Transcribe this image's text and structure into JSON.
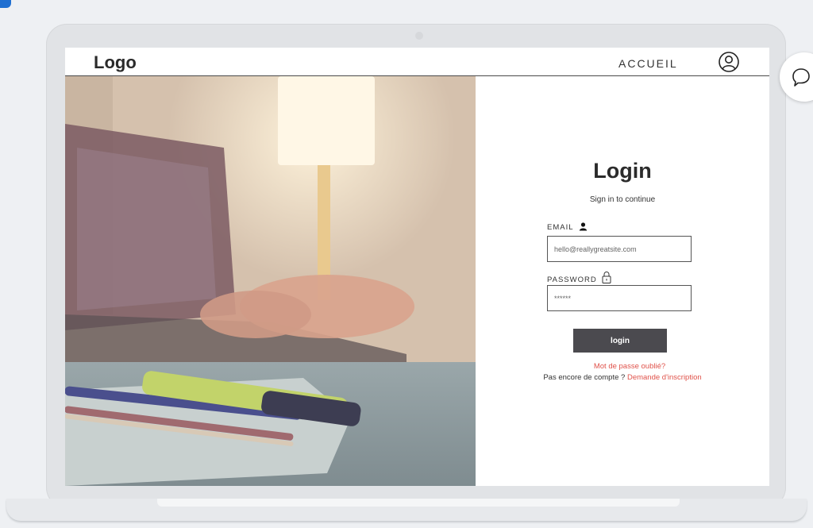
{
  "header": {
    "logo": "Logo",
    "nav_link": "ACCUEIL",
    "user_icon": "user-circle-icon"
  },
  "login": {
    "title": "Login",
    "subtitle": "Sign in to continue",
    "email_label": "EMAIL",
    "email_icon": "person-icon",
    "email_value": "hello@reallygreatsite.com",
    "password_label": "PASSWORD",
    "password_icon": "lock-icon",
    "password_value": "******",
    "button_label": "login",
    "forgot_password": "Mot de passe oublié?",
    "no_account_text": "Pas encore de compte ?",
    "register_link": "Demande d'inscription"
  },
  "chat": {
    "icon": "chat-bubble-icon"
  },
  "colors": {
    "accent": "#e0534b",
    "button": "#4b4a4f",
    "text_dark": "#2b2b2b"
  }
}
